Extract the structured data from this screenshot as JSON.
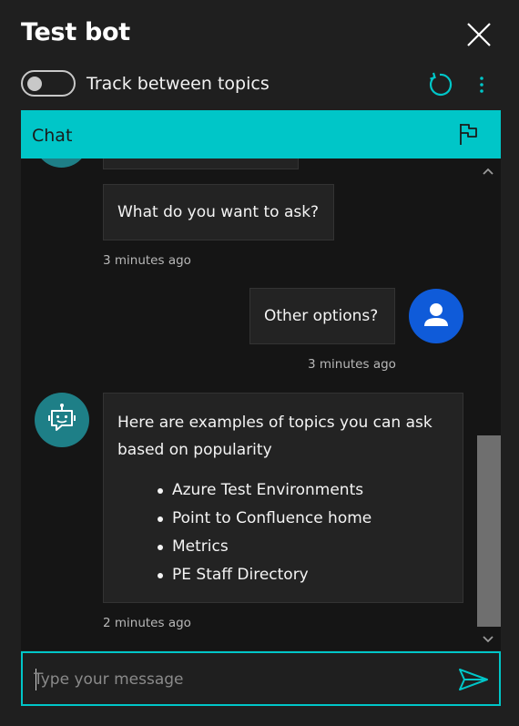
{
  "app": {
    "title": "Test bot",
    "track_label": "Track between topics",
    "track_enabled": false
  },
  "chat": {
    "tab_label": "Chat",
    "messages": [
      {
        "sender": "bot",
        "text": "What do you want to ask?",
        "time": "3 minutes ago"
      },
      {
        "sender": "user",
        "text": "Other options?",
        "time": "3 minutes ago"
      },
      {
        "sender": "bot",
        "text": "Here are examples of topics you can ask based on popularity",
        "items": [
          "Azure Test Environments",
          "Point to Confluence home",
          "Metrics",
          "PE Staff Directory"
        ],
        "time": "2 minutes ago"
      }
    ]
  },
  "composer": {
    "placeholder": "Type your message",
    "value": ""
  },
  "icons": {
    "close": "close-icon",
    "refresh": "refresh-icon",
    "more": "more-vertical-icon",
    "flag": "flag-icon",
    "bot": "bot-icon",
    "user": "user-icon",
    "send": "send-icon"
  },
  "colors": {
    "accent": "#00c6c8",
    "bot_avatar": "#1e7f87",
    "user_avatar": "#0f5bd9",
    "background": "#1f1f1f"
  }
}
